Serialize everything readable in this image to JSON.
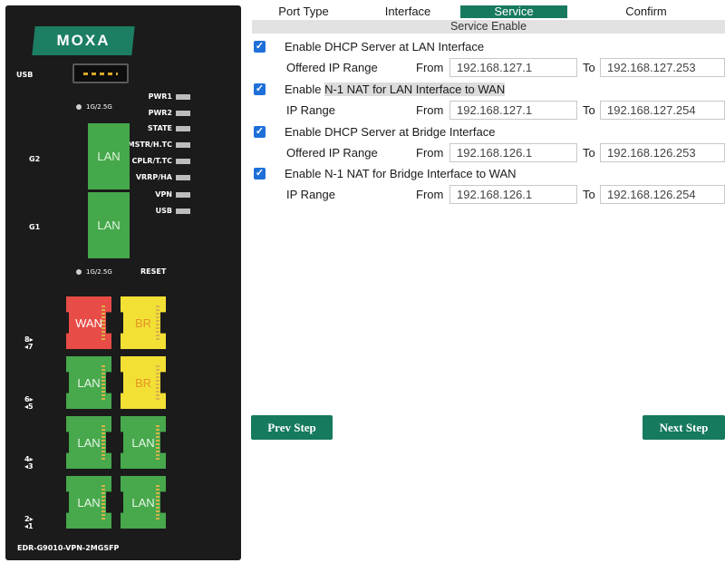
{
  "device": {
    "brand": "MOXA",
    "model": "EDR-G9010-VPN-2MGSFP",
    "usb_label": "USB",
    "leds": [
      "PWR1",
      "PWR2",
      "STATE",
      "MSTR/H.TC",
      "CPLR/T.TC",
      "VRRP/HA",
      "VPN",
      "USB"
    ],
    "speed_label_top": "1G/2.5G",
    "speed_label_bottom": "1G/2.5G",
    "reset_label": "RESET",
    "g2_label": "G2",
    "g1_label": "G1",
    "g2_port": "LAN",
    "g1_port": "LAN",
    "port_pairs": [
      {
        "label_top": "8",
        "label_bottom": "7",
        "left": "WAN",
        "right": "BR"
      },
      {
        "label_top": "6",
        "label_bottom": "5",
        "left": "LAN",
        "right": "BR"
      },
      {
        "label_top": "4",
        "label_bottom": "3",
        "left": "LAN",
        "right": "LAN"
      },
      {
        "label_top": "2",
        "label_bottom": "1",
        "left": "LAN",
        "right": "LAN"
      }
    ],
    "colors": {
      "lan": "#47a84c",
      "wan": "#e84c46",
      "br": "#f2e035",
      "brand": "#1c7e63"
    }
  },
  "wizard": {
    "steps": [
      "Port Type",
      "Interface",
      "Service",
      "Confirm"
    ],
    "active_step": "Service",
    "section_title": "Service Enable",
    "options": [
      {
        "label": "Enable DHCP Server at LAN Interface",
        "checked": true,
        "range_label": "Offered IP Range",
        "from_label": "From",
        "from": "192.168.127.1",
        "to_label": "To",
        "to": "192.168.127.253"
      },
      {
        "label_prefix": "Enable ",
        "label_highlight": "N-1 NAT for LAN Interface to WAN",
        "checked": true,
        "range_label": "IP Range",
        "from_label": "From",
        "from": "192.168.127.1",
        "to_label": "To",
        "to": "192.168.127.254"
      },
      {
        "label": "Enable DHCP Server at Bridge Interface",
        "checked": true,
        "range_label": "Offered IP Range",
        "from_label": "From",
        "from": "192.168.126.1",
        "to_label": "To",
        "to": "192.168.126.253"
      },
      {
        "label": "Enable N-1 NAT for Bridge Interface to WAN",
        "checked": true,
        "range_label": "IP Range",
        "from_label": "From",
        "from": "192.168.126.1",
        "to_label": "To",
        "to": "192.168.126.254"
      }
    ],
    "prev_button": "Prev Step",
    "next_button": "Next Step",
    "accent": "#177a5f",
    "checkbox_color": "#1f6fd8"
  }
}
